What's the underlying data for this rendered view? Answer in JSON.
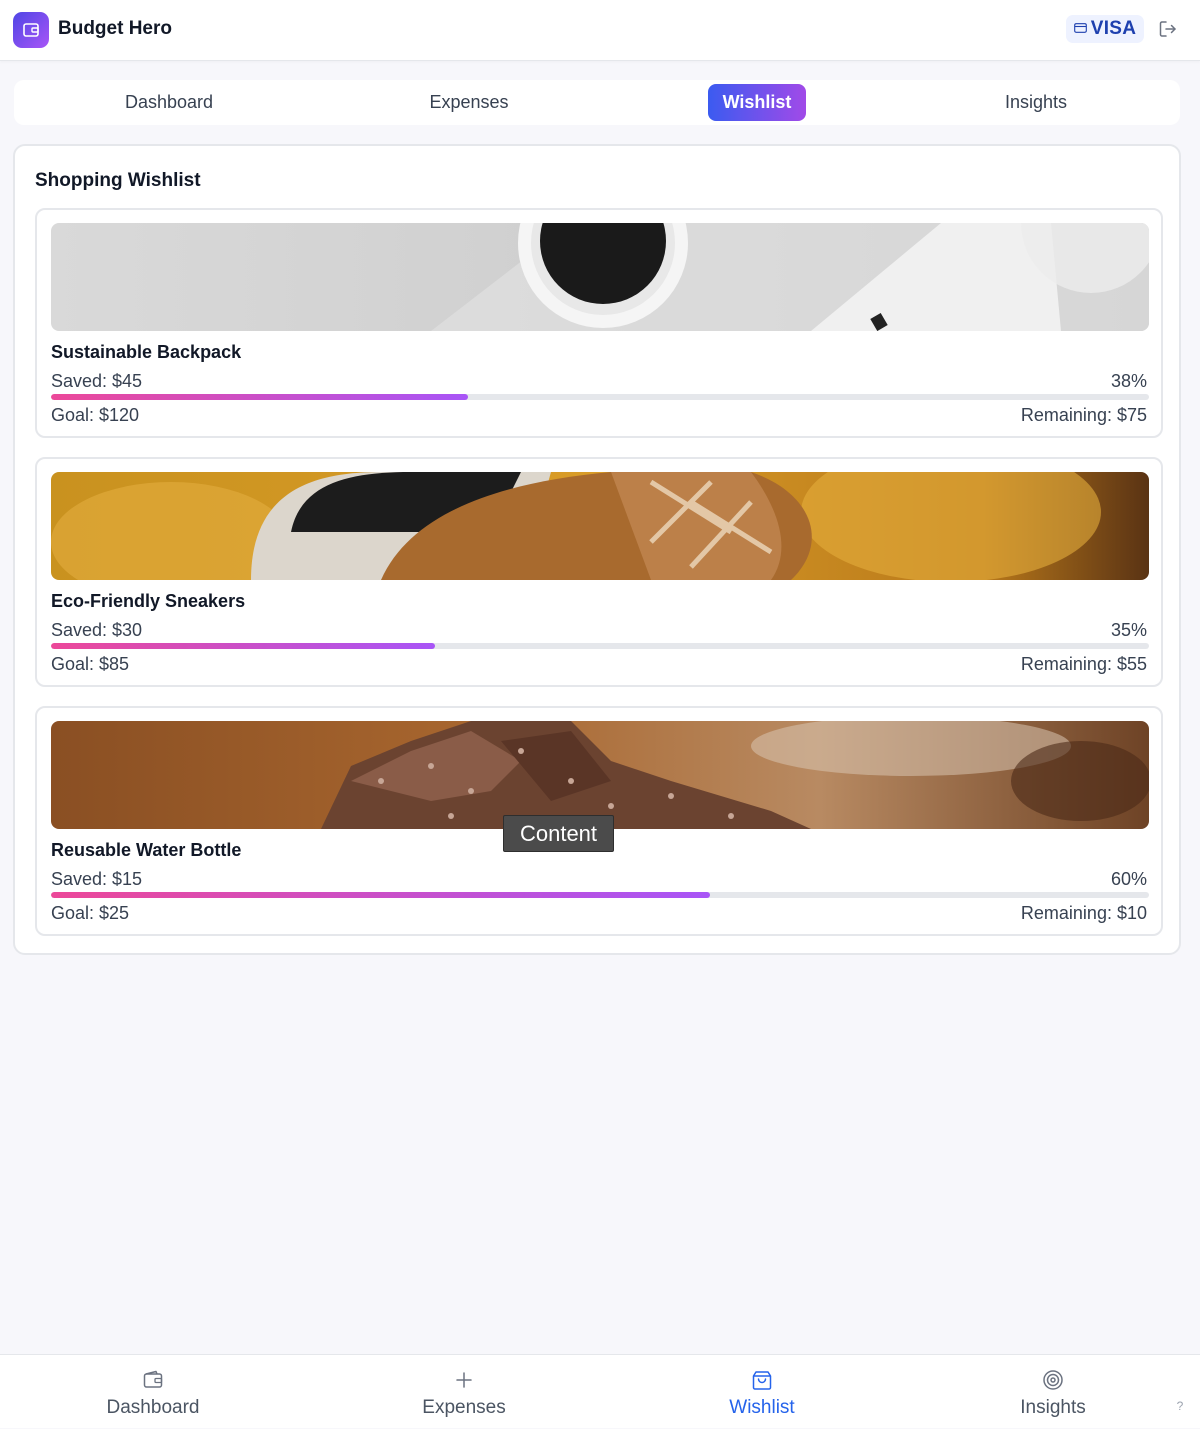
{
  "header": {
    "app_title": "Budget Hero",
    "card_brand": "VISA",
    "logo_icon": "wallet-icon",
    "logout_icon": "logout-icon"
  },
  "tabs": [
    {
      "label": "Dashboard",
      "active": false
    },
    {
      "label": "Expenses",
      "active": false
    },
    {
      "label": "Wishlist",
      "active": true
    },
    {
      "label": "Insights",
      "active": false
    }
  ],
  "wishlist": {
    "title": "Shopping Wishlist",
    "items": [
      {
        "name": "Sustainable Backpack",
        "saved": "Saved: $45",
        "percent": "38%",
        "progress": 0.38,
        "goal": "Goal: $120",
        "remaining": "Remaining: $75"
      },
      {
        "name": "Eco-Friendly Sneakers",
        "saved": "Saved: $30",
        "percent": "35%",
        "progress": 0.35,
        "goal": "Goal: $85",
        "remaining": "Remaining: $55"
      },
      {
        "name": "Reusable Water Bottle",
        "saved": "Saved: $15",
        "percent": "60%",
        "progress": 0.6,
        "goal": "Goal: $25",
        "remaining": "Remaining: $10"
      }
    ]
  },
  "tooltip": {
    "text": "Content"
  },
  "bottom_nav": [
    {
      "label": "Dashboard",
      "icon": "wallet-icon",
      "active": false
    },
    {
      "label": "Expenses",
      "icon": "plus-icon",
      "active": false
    },
    {
      "label": "Wishlist",
      "icon": "shopping-bag-icon",
      "active": true
    },
    {
      "label": "Insights",
      "icon": "target-icon",
      "active": false
    }
  ],
  "help": {
    "label": "?"
  },
  "colors": {
    "accent_start": "#3b5bf0",
    "accent_end": "#a14ae8",
    "progress_start": "#ec4899",
    "progress_end": "#a855f7",
    "active_nav": "#2563eb"
  }
}
